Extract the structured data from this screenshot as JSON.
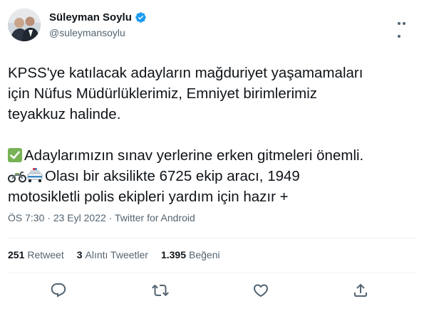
{
  "author": {
    "name": "Süleyman Soylu",
    "handle": "@suleymansoylu",
    "verified": true
  },
  "tweet": {
    "line1": "KPSS'ye katılacak adayların mağduriyet yaşamamaları",
    "line2": "için Nüfus Müdürlüklerimiz, Emniyet birimlerimiz",
    "line3": "teyakkuz halinde.",
    "line4": "Adaylarımızın sınav yerlerine erken gitmeleri önemli.",
    "line5": "Olası bir aksilikte 6725 ekip aracı, 1949",
    "line6": "motosikletli polis ekipleri yardım için hazır +"
  },
  "meta": {
    "time": "ÖS 7:30",
    "sep": " · ",
    "date": "23 Eyl 2022",
    "source": "Twitter for Android"
  },
  "stats": {
    "retweets_count": "251",
    "retweets_label": "Retweet",
    "quotes_count": "3",
    "quotes_label": "Alıntı Tweetler",
    "likes_count": "1.395",
    "likes_label": "Beğeni"
  },
  "colors": {
    "text": "#0f1419",
    "secondary": "#536471",
    "verified": "#1d9bf0",
    "divider": "#eff3f4"
  },
  "icons": [
    "verified-badge-icon",
    "more-icon",
    "check-mark-emoji",
    "motorcycle-emoji",
    "police-car-emoji",
    "reply-icon",
    "retweet-icon",
    "like-icon",
    "share-icon"
  ]
}
